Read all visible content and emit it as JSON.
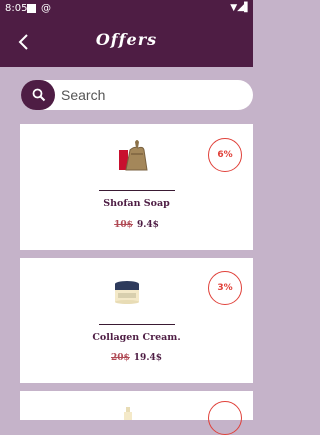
{
  "status_bar": {
    "time": "8:05",
    "at_icon": "@"
  },
  "header": {
    "title": "Offers",
    "back_icon": "back-arrow-icon"
  },
  "search": {
    "placeholder": "Search",
    "value": ""
  },
  "offers": [
    {
      "name": "Shofan Soap",
      "old_price": "10$",
      "new_price": "9.4$",
      "discount": "6%"
    },
    {
      "name": "Collagen Cream.",
      "old_price": "20$",
      "new_price": "19.4$",
      "discount": "3%"
    }
  ],
  "colors": {
    "primary": "#4e1d44",
    "background": "#c5b3c9",
    "discount": "#e0413a",
    "old_price": "#b04a55"
  }
}
